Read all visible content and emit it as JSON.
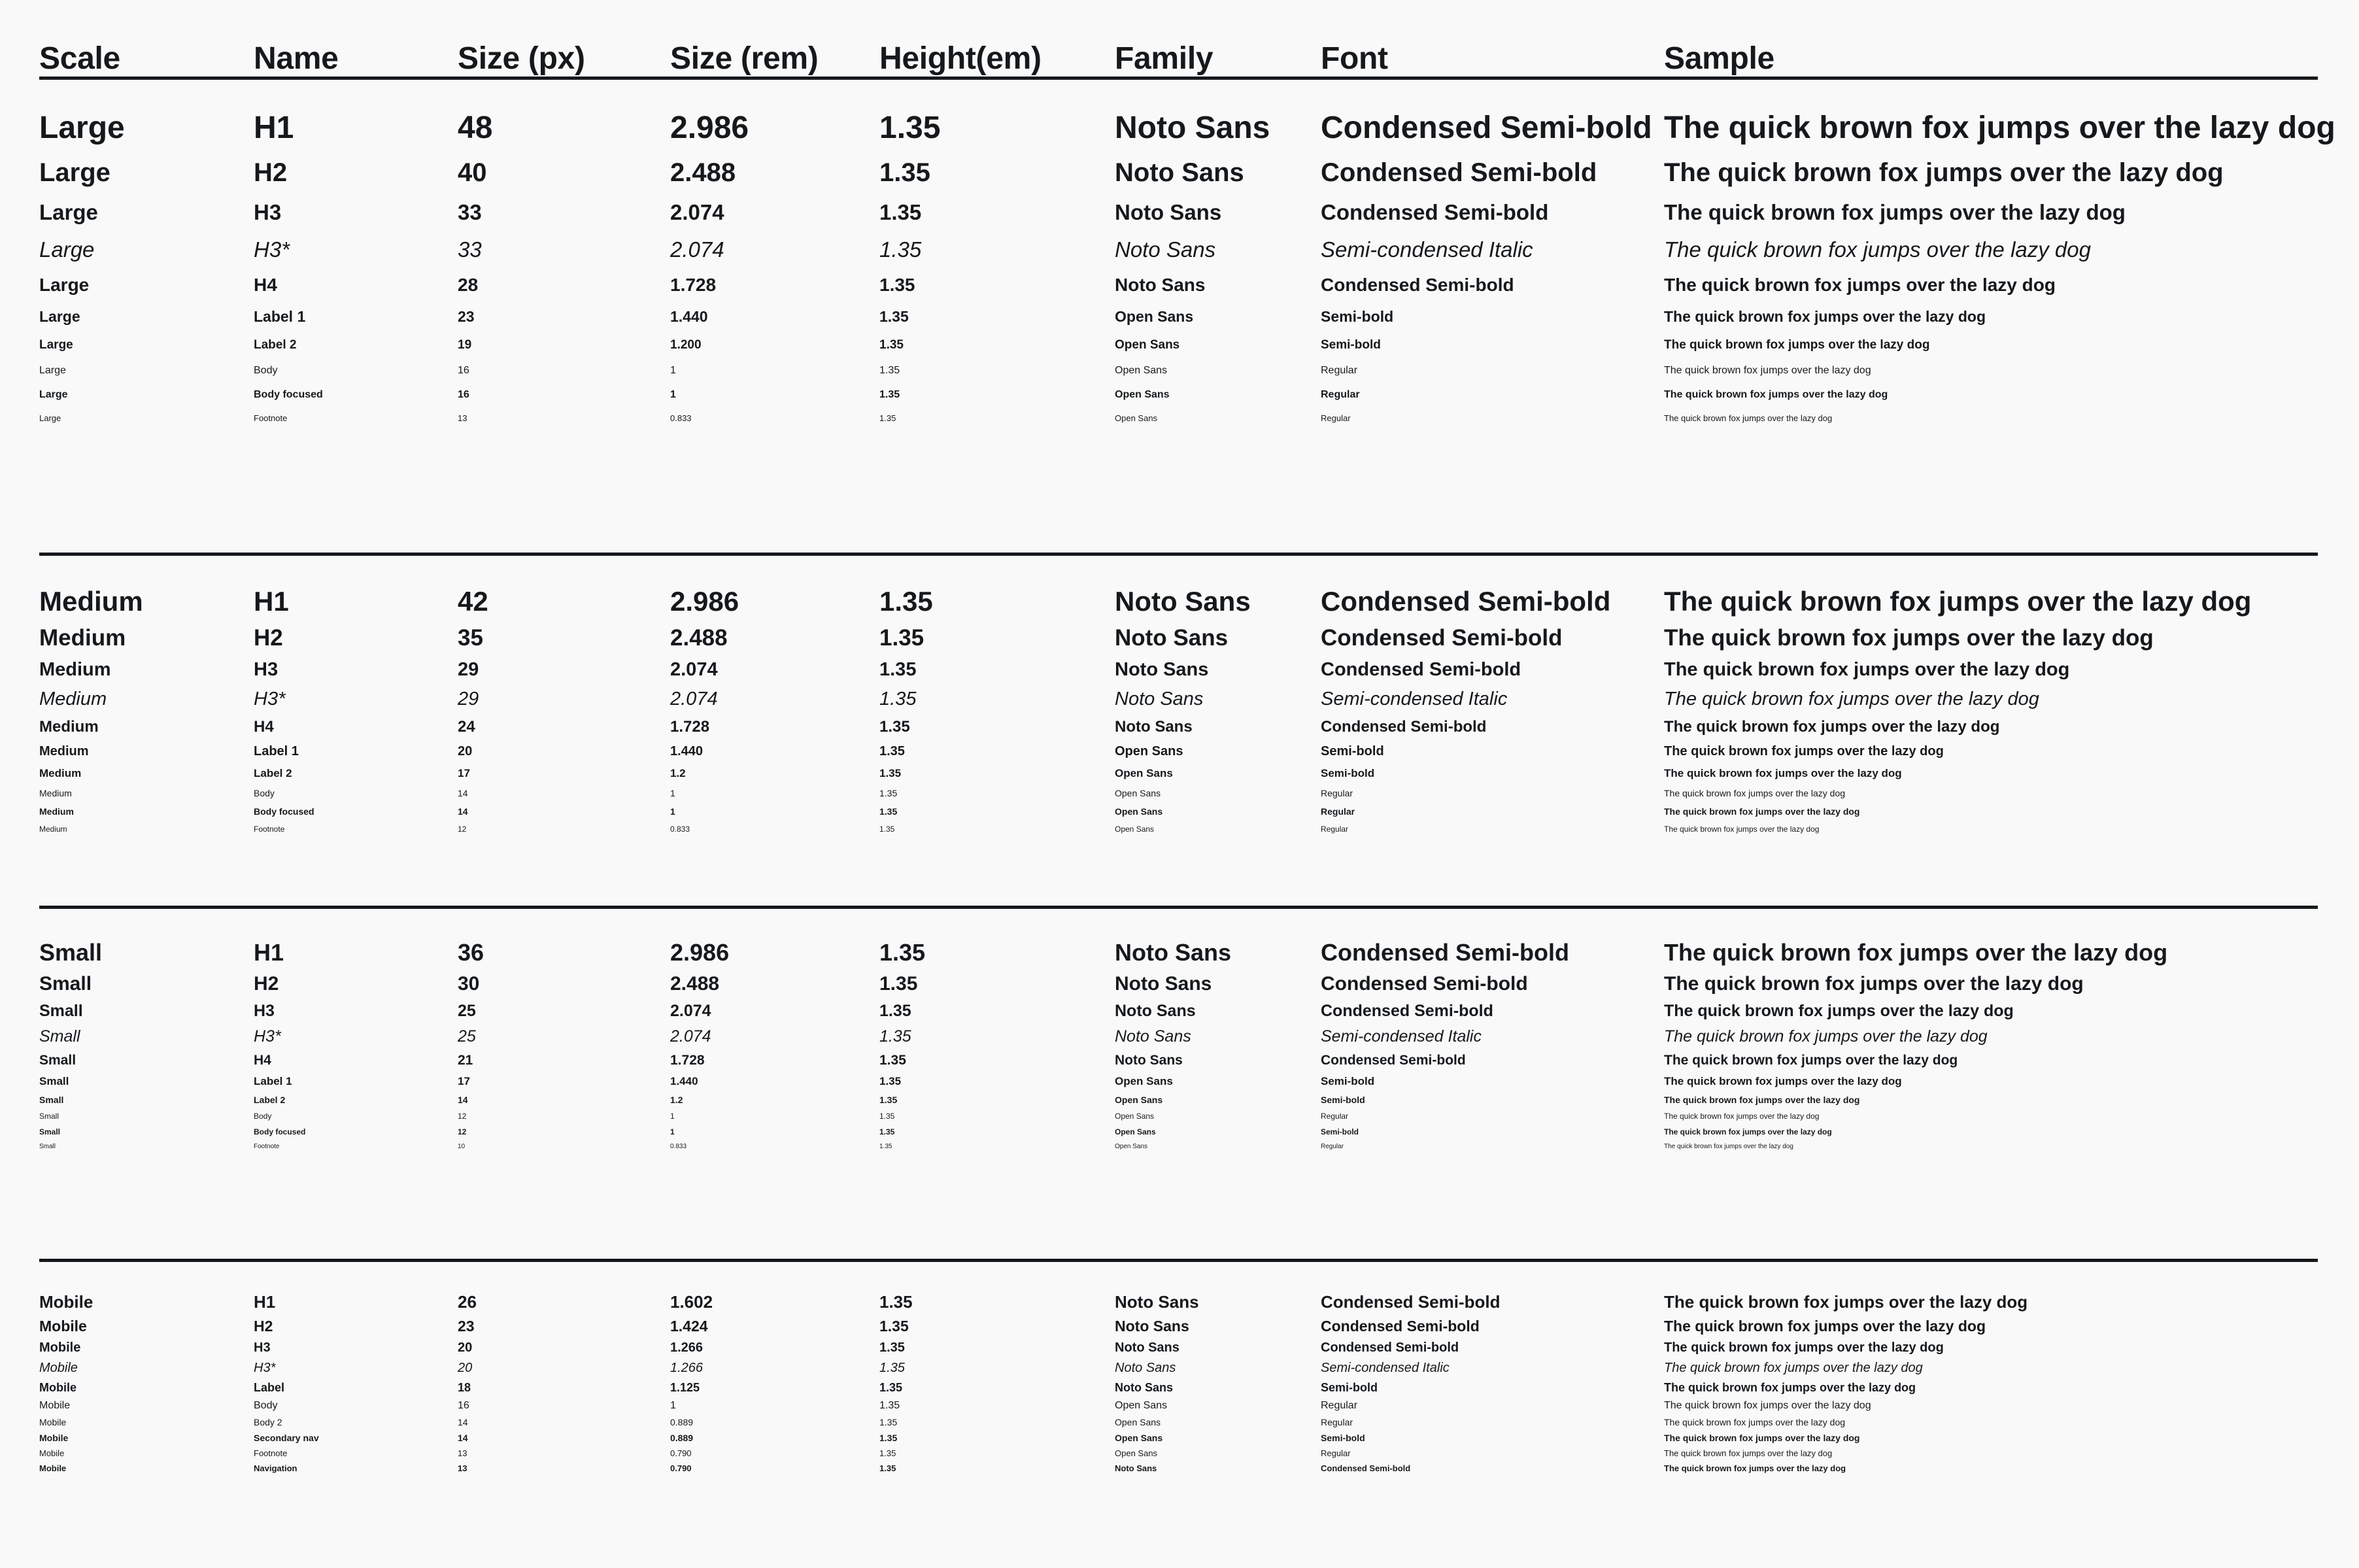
{
  "table": {
    "columns": [
      {
        "key": "scale",
        "label": "Scale"
      },
      {
        "key": "name",
        "label": "Name"
      },
      {
        "key": "px",
        "label": "Size (px)"
      },
      {
        "key": "rem",
        "label": "Size (rem)"
      },
      {
        "key": "height",
        "label": "Height(em)"
      },
      {
        "key": "family",
        "label": "Family"
      },
      {
        "key": "font",
        "label": "Font"
      },
      {
        "key": "sample",
        "label": "Sample"
      }
    ],
    "sample_text": "The quick brown fox jumps over the lazy dog",
    "colors": {
      "background": "#f9f9f9",
      "text": "#16191c",
      "muted_text": "#3c4043",
      "rule": "#16191c"
    },
    "sections": [
      {
        "id": "large",
        "scale": "Large",
        "rows": [
          {
            "style": "r-h1",
            "scale": "Large",
            "name": "H1",
            "px": "48",
            "rem": "2.986",
            "height": "1.35",
            "family": "Noto Sans",
            "font": "Condensed Semi-bold",
            "sample": "The quick brown fox jumps over the lazy dog"
          },
          {
            "style": "r-h2",
            "scale": "Large",
            "name": "H2",
            "px": "40",
            "rem": "2.488",
            "height": "1.35",
            "family": "Noto Sans",
            "font": "Condensed Semi-bold",
            "sample": "The quick brown fox jumps over the lazy dog"
          },
          {
            "style": "r-h3",
            "scale": "Large",
            "name": "H3",
            "px": "33",
            "rem": "2.074",
            "height": "1.35",
            "family": "Noto Sans",
            "font": "Condensed Semi-bold",
            "sample": "The quick brown fox jumps over the lazy dog"
          },
          {
            "style": "r-h3i",
            "scale": "Large",
            "name": "H3*",
            "px": "33",
            "rem": "2.074",
            "height": "1.35",
            "family": "Noto Sans",
            "font": "Semi-condensed Italic",
            "sample": "The quick brown fox jumps over the lazy dog"
          },
          {
            "style": "r-h4",
            "scale": "Large",
            "name": "H4",
            "px": "28",
            "rem": "1.728",
            "height": "1.35",
            "family": "Noto Sans",
            "font": "Condensed Semi-bold",
            "sample": "The quick brown fox jumps over the lazy dog"
          },
          {
            "style": "r-l1",
            "scale": "Large",
            "name": "Label 1",
            "px": "23",
            "rem": "1.440",
            "height": "1.35",
            "family": "Open Sans",
            "font": "Semi-bold",
            "sample": "The quick brown fox jumps over the lazy dog"
          },
          {
            "style": "r-l2",
            "scale": "Large",
            "name": "Label 2",
            "px": "19",
            "rem": "1.200",
            "height": "1.35",
            "family": "Open Sans",
            "font": "Semi-bold",
            "sample": "The quick brown fox jumps over the lazy dog"
          },
          {
            "style": "r-body",
            "scale": "Large",
            "name": "Body",
            "px": "16",
            "rem": "1",
            "height": "1.35",
            "family": "Open Sans",
            "font": "Regular",
            "sample": "The quick brown fox jumps over the lazy dog"
          },
          {
            "style": "r-bodyf",
            "scale": "Large",
            "name": "Body focused",
            "px": "16",
            "rem": "1",
            "height": "1.35",
            "family": "Open Sans",
            "font": "Regular",
            "sample": "The quick brown fox jumps over the lazy dog"
          },
          {
            "style": "r-foot",
            "scale": "Large",
            "name": "Footnote",
            "px": "13",
            "rem": "0.833",
            "height": "1.35",
            "family": "Open Sans",
            "font": "Regular",
            "sample": "The quick brown fox jumps over the lazy dog"
          }
        ]
      },
      {
        "id": "medium",
        "scale": "Medium",
        "rows": [
          {
            "style": "m-h1",
            "scale": "Medium",
            "name": "H1",
            "px": "42",
            "rem": "2.986",
            "height": "1.35",
            "family": "Noto Sans",
            "font": "Condensed Semi-bold",
            "sample": "The quick brown fox jumps over the lazy dog"
          },
          {
            "style": "m-h2",
            "scale": "Medium",
            "name": "H2",
            "px": "35",
            "rem": "2.488",
            "height": "1.35",
            "family": "Noto Sans",
            "font": "Condensed Semi-bold",
            "sample": "The quick brown fox jumps over the lazy dog"
          },
          {
            "style": "m-h3",
            "scale": "Medium",
            "name": "H3",
            "px": "29",
            "rem": "2.074",
            "height": "1.35",
            "family": "Noto Sans",
            "font": "Condensed Semi-bold",
            "sample": "The quick brown fox jumps over the lazy dog"
          },
          {
            "style": "m-h3i",
            "scale": "Medium",
            "name": "H3*",
            "px": "29",
            "rem": "2.074",
            "height": "1.35",
            "family": "Noto Sans",
            "font": "Semi-condensed Italic",
            "sample": "The quick brown fox jumps over the lazy dog"
          },
          {
            "style": "m-h4",
            "scale": "Medium",
            "name": "H4",
            "px": "24",
            "rem": "1.728",
            "height": "1.35",
            "family": "Noto Sans",
            "font": "Condensed Semi-bold",
            "sample": "The quick brown fox jumps over the lazy dog"
          },
          {
            "style": "m-l1",
            "scale": "Medium",
            "name": "Label 1",
            "px": "20",
            "rem": "1.440",
            "height": "1.35",
            "family": "Open Sans",
            "font": "Semi-bold",
            "sample": "The quick brown fox jumps over the lazy dog"
          },
          {
            "style": "m-l2",
            "scale": "Medium",
            "name": "Label 2",
            "px": "17",
            "rem": "1.2",
            "height": "1.35",
            "family": "Open Sans",
            "font": "Semi-bold",
            "sample": "The quick brown fox jumps over the lazy dog"
          },
          {
            "style": "m-body",
            "scale": "Medium",
            "name": "Body",
            "px": "14",
            "rem": "1",
            "height": "1.35",
            "family": "Open Sans",
            "font": "Regular",
            "sample": "The quick brown fox jumps over the lazy dog"
          },
          {
            "style": "m-bodyf",
            "scale": "Medium",
            "name": "Body focused",
            "px": "14",
            "rem": "1",
            "height": "1.35",
            "family": "Open Sans",
            "font": "Regular",
            "sample": "The quick brown fox jumps over the lazy dog"
          },
          {
            "style": "m-foot",
            "scale": "Medium",
            "name": "Footnote",
            "px": "12",
            "rem": "0.833",
            "height": "1.35",
            "family": "Open Sans",
            "font": "Regular",
            "sample": "The quick brown fox jumps over the lazy dog"
          }
        ]
      },
      {
        "id": "small",
        "scale": "Small",
        "rows": [
          {
            "style": "s-h1",
            "scale": "Small",
            "name": "H1",
            "px": "36",
            "rem": "2.986",
            "height": "1.35",
            "family": "Noto Sans",
            "font": "Condensed Semi-bold",
            "sample": "The quick brown fox jumps over the lazy dog"
          },
          {
            "style": "s-h2",
            "scale": "Small",
            "name": "H2",
            "px": "30",
            "rem": "2.488",
            "height": "1.35",
            "family": "Noto Sans",
            "font": "Condensed Semi-bold",
            "sample": "The quick brown fox jumps over the lazy dog"
          },
          {
            "style": "s-h3",
            "scale": "Small",
            "name": "H3",
            "px": "25",
            "rem": "2.074",
            "height": "1.35",
            "family": "Noto Sans",
            "font": "Condensed Semi-bold",
            "sample": "The quick brown fox jumps over the lazy dog"
          },
          {
            "style": "s-h3i",
            "scale": "Small",
            "name": "H3*",
            "px": "25",
            "rem": "2.074",
            "height": "1.35",
            "family": "Noto Sans",
            "font": "Semi-condensed Italic",
            "sample": "The quick brown fox jumps over the lazy dog"
          },
          {
            "style": "s-h4",
            "scale": "Small",
            "name": "H4",
            "px": "21",
            "rem": "1.728",
            "height": "1.35",
            "family": "Noto Sans",
            "font": "Condensed Semi-bold",
            "sample": "The quick brown fox jumps over the lazy dog"
          },
          {
            "style": "s-l1",
            "scale": "Small",
            "name": "Label 1",
            "px": "17",
            "rem": "1.440",
            "height": "1.35",
            "family": "Open Sans",
            "font": "Semi-bold",
            "sample": "The quick brown fox jumps over the lazy dog"
          },
          {
            "style": "s-l2",
            "scale": "Small",
            "name": "Label 2",
            "px": "14",
            "rem": "1.2",
            "height": "1.35",
            "family": "Open Sans",
            "font": "Semi-bold",
            "sample": "The quick brown fox jumps over the lazy dog"
          },
          {
            "style": "s-body",
            "scale": "Small",
            "name": "Body",
            "px": "12",
            "rem": "1",
            "height": "1.35",
            "family": "Open Sans",
            "font": "Regular",
            "sample": "The quick brown fox jumps over the lazy dog"
          },
          {
            "style": "s-bodyf",
            "scale": "Small",
            "name": "Body focused",
            "px": "12",
            "rem": "1",
            "height": "1.35",
            "family": "Open Sans",
            "font": "Semi-bold",
            "sample": "The quick brown fox jumps over the lazy dog"
          },
          {
            "style": "s-foot",
            "scale": "Small",
            "name": "Footnote",
            "px": "10",
            "rem": "0.833",
            "height": "1.35",
            "family": "Open Sans",
            "font": "Regular",
            "sample": "The quick brown fox jumps over the lazy dog"
          }
        ]
      },
      {
        "id": "mobile",
        "scale": "Mobile",
        "rows": [
          {
            "style": "b-h1",
            "scale": "Mobile",
            "name": "H1",
            "px": "26",
            "rem": "1.602",
            "height": "1.35",
            "family": "Noto Sans",
            "font": "Condensed Semi-bold",
            "sample": "The quick brown fox jumps over the lazy dog"
          },
          {
            "style": "b-h2",
            "scale": "Mobile",
            "name": "H2",
            "px": "23",
            "rem": "1.424",
            "height": "1.35",
            "family": "Noto Sans",
            "font": "Condensed Semi-bold",
            "sample": "The quick brown fox jumps over the lazy dog"
          },
          {
            "style": "b-h3",
            "scale": "Mobile",
            "name": "H3",
            "px": "20",
            "rem": "1.266",
            "height": "1.35",
            "family": "Noto Sans",
            "font": "Condensed Semi-bold",
            "sample": "The quick brown fox jumps over the lazy dog"
          },
          {
            "style": "b-h3i",
            "scale": "Mobile",
            "name": "H3*",
            "px": "20",
            "rem": "1.266",
            "height": "1.35",
            "family": "Noto Sans",
            "font": "Semi-condensed Italic",
            "sample": "The quick brown fox jumps over the lazy dog"
          },
          {
            "style": "b-lab",
            "scale": "Mobile",
            "name": "Label",
            "px": "18",
            "rem": "1.125",
            "height": "1.35",
            "family": "Noto Sans",
            "font": "Semi-bold",
            "sample": "The quick brown fox jumps over the lazy dog"
          },
          {
            "style": "b-body",
            "scale": "Mobile",
            "name": "Body",
            "px": "16",
            "rem": "1",
            "height": "1.35",
            "family": "Open Sans",
            "font": "Regular",
            "sample": "The quick brown fox jumps over the lazy dog"
          },
          {
            "style": "b-body2",
            "scale": "Mobile",
            "name": "Body 2",
            "px": "14",
            "rem": "0.889",
            "height": "1.35",
            "family": "Open Sans",
            "font": "Regular",
            "sample": "The quick brown fox jumps over the lazy dog"
          },
          {
            "style": "b-sec",
            "scale": "Mobile",
            "name": "Secondary nav",
            "px": "14",
            "rem": "0.889",
            "height": "1.35",
            "family": "Open Sans",
            "font": "Semi-bold",
            "sample": "The quick brown fox jumps over the lazy dog"
          },
          {
            "style": "b-foot",
            "scale": "Mobile",
            "name": "Footnote",
            "px": "13",
            "rem": "0.790",
            "height": "1.35",
            "family": "Open Sans",
            "font": "Regular",
            "sample": "The quick brown fox jumps over the lazy dog"
          },
          {
            "style": "b-nav",
            "scale": "Mobile",
            "name": "Navigation",
            "px": "13",
            "rem": "0.790",
            "height": "1.35",
            "family": "Noto Sans",
            "font": "Condensed Semi-bold",
            "sample": "The quick brown fox jumps over the lazy dog"
          }
        ]
      }
    ]
  }
}
